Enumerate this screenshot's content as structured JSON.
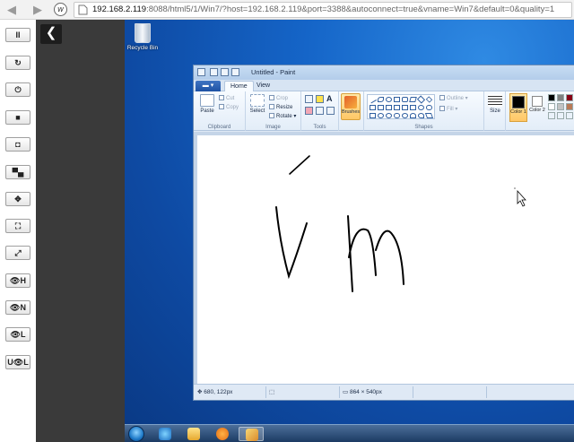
{
  "browser": {
    "url_host": "192.168.2.119",
    "url_rest": ":8088/html5/1/Win7/?host=192.168.2.119&port=3388&autoconnect=true&vname=Win7&default=0&quality=1",
    "back_icon": "arrow-left-icon",
    "forward_icon": "arrow-right-icon"
  },
  "toolbar": {
    "buttons": [
      {
        "name": "pause",
        "glyph": "II"
      },
      {
        "name": "refresh",
        "glyph": "↻"
      },
      {
        "name": "power",
        "glyph": "⏻"
      },
      {
        "name": "stop",
        "glyph": "■"
      },
      {
        "name": "screenshot",
        "glyph": "◘"
      },
      {
        "name": "keyboard",
        "glyph": "▀▄"
      },
      {
        "name": "mouse-move",
        "glyph": "✥"
      },
      {
        "name": "fit-screen",
        "glyph": "⛶"
      },
      {
        "name": "fullscreen",
        "glyph": "⤢"
      },
      {
        "name": "view-h",
        "glyph": "👁H"
      },
      {
        "name": "view-n",
        "glyph": "👁N"
      },
      {
        "name": "view-l",
        "glyph": "👁L"
      },
      {
        "name": "view-ul",
        "glyph": "U👁L"
      }
    ]
  },
  "side_panel": {
    "collapse_glyph": "❮"
  },
  "desktop": {
    "recycle_bin_label": "Recycle Bin"
  },
  "paint": {
    "title": "Untitled - Paint",
    "tabs": {
      "home": "Home",
      "view": "View"
    },
    "clipboard": {
      "paste": "Paste",
      "cut": "Cut",
      "copy": "Copy",
      "label": "Clipboard"
    },
    "image": {
      "select": "Select",
      "crop": "Crop",
      "resize": "Resize",
      "rotate": "Rotate ▾",
      "label": "Image"
    },
    "tools": {
      "label": "Tools"
    },
    "brushes": {
      "label": "Brushes"
    },
    "shapes": {
      "outline": "Outline ▾",
      "fill": "Fill ▾",
      "label": "Shapes"
    },
    "size": {
      "label": "Size"
    },
    "colors": {
      "color1": "Color 1",
      "color2": "Color 2"
    },
    "palette": [
      "#000000",
      "#7f7f7f",
      "#880015",
      "#ed1c24",
      "#ffffff",
      "#c3c3c3",
      "#b97a57",
      "#ffaec9"
    ],
    "status": {
      "cursor_pos": "680, 122px",
      "canvas_size": "864 × 540px"
    }
  },
  "accent": "#1565c8"
}
